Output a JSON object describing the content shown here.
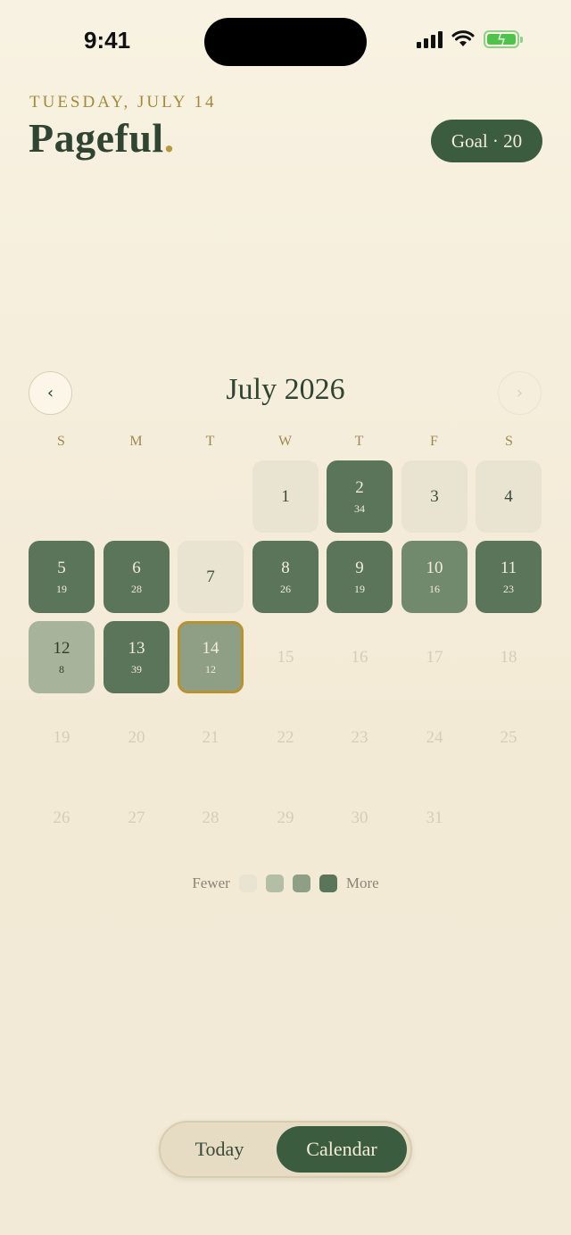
{
  "status_bar": {
    "time": "9:41"
  },
  "header": {
    "date": "TUESDAY, JULY 14",
    "title": "Pageful",
    "title_dot": ".",
    "goal_label": "Goal · 20"
  },
  "calendar": {
    "month_title": "July 2026",
    "prev_icon": "‹",
    "next_icon": "›",
    "weekdays": [
      "S",
      "M",
      "T",
      "W",
      "T",
      "F",
      "S"
    ],
    "today": 14,
    "days": [
      {
        "day": "1",
        "count": "",
        "level": 0
      },
      {
        "day": "2",
        "count": "34",
        "level": 4
      },
      {
        "day": "3",
        "count": "",
        "level": 0
      },
      {
        "day": "4",
        "count": "",
        "level": 0
      },
      {
        "day": "5",
        "count": "19",
        "level": 4
      },
      {
        "day": "6",
        "count": "28",
        "level": 4
      },
      {
        "day": "7",
        "count": "",
        "level": 0
      },
      {
        "day": "8",
        "count": "26",
        "level": 4
      },
      {
        "day": "9",
        "count": "19",
        "level": 4
      },
      {
        "day": "10",
        "count": "16",
        "level": 3
      },
      {
        "day": "11",
        "count": "23",
        "level": 4
      },
      {
        "day": "12",
        "count": "8",
        "level": 1
      },
      {
        "day": "13",
        "count": "39",
        "level": 4
      },
      {
        "day": "14",
        "count": "12",
        "level": 2
      },
      {
        "day": "15",
        "count": "",
        "level": "future"
      },
      {
        "day": "16",
        "count": "",
        "level": "future"
      },
      {
        "day": "17",
        "count": "",
        "level": "future"
      },
      {
        "day": "18",
        "count": "",
        "level": "future"
      },
      {
        "day": "19",
        "count": "",
        "level": "future"
      },
      {
        "day": "20",
        "count": "",
        "level": "future"
      },
      {
        "day": "21",
        "count": "",
        "level": "future"
      },
      {
        "day": "22",
        "count": "",
        "level": "future"
      },
      {
        "day": "23",
        "count": "",
        "level": "future"
      },
      {
        "day": "24",
        "count": "",
        "level": "future"
      },
      {
        "day": "25",
        "count": "",
        "level": "future"
      },
      {
        "day": "26",
        "count": "",
        "level": "future"
      },
      {
        "day": "27",
        "count": "",
        "level": "future"
      },
      {
        "day": "28",
        "count": "",
        "level": "future"
      },
      {
        "day": "29",
        "count": "",
        "level": "future"
      },
      {
        "day": "30",
        "count": "",
        "level": "future"
      },
      {
        "day": "31",
        "count": "",
        "level": "future"
      }
    ]
  },
  "legend": {
    "fewer_label": "Fewer",
    "more_label": "More",
    "colors": [
      "#e9e4d1",
      "#b3bea5",
      "#8e9f86",
      "#5a7559"
    ]
  },
  "tabs": {
    "today_label": "Today",
    "calendar_label": "Calendar",
    "active": "Calendar"
  },
  "colors": {
    "accent": "#3c5c40",
    "gold": "#b99a3a",
    "background": "#f5eedc"
  }
}
